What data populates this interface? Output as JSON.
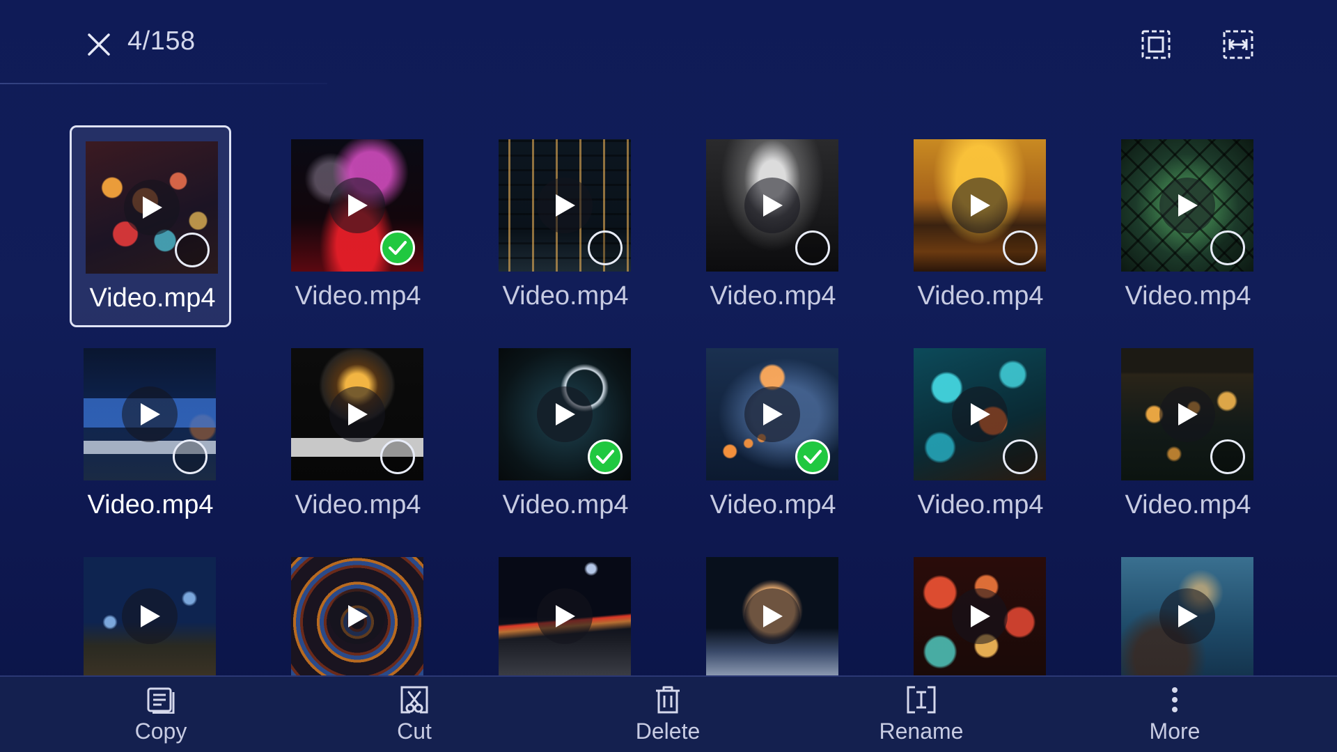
{
  "header": {
    "counter": "4/158",
    "close_icon": "close-icon",
    "select_all_icon": "select-all-icon",
    "select_range_icon": "select-range-icon"
  },
  "grid": {
    "items": [
      {
        "name": "Video.mp4",
        "selected": false,
        "focused": true,
        "theme": "bokeh-lights"
      },
      {
        "name": "Video.mp4",
        "selected": true,
        "focused": false,
        "theme": "fireworks-concert"
      },
      {
        "name": "Video.mp4",
        "selected": false,
        "focused": false,
        "theme": "night-city"
      },
      {
        "name": "Video.mp4",
        "selected": false,
        "focused": false,
        "theme": "concert-crowd"
      },
      {
        "name": "Video.mp4",
        "selected": false,
        "focused": false,
        "theme": "autumn-forest"
      },
      {
        "name": "Video.mp4",
        "selected": false,
        "focused": false,
        "theme": "green-window"
      },
      {
        "name": "Video.mp4",
        "selected": false,
        "focused": false,
        "theme": "control-room"
      },
      {
        "name": "Video.mp4",
        "selected": false,
        "focused": false,
        "theme": "light-bulb"
      },
      {
        "name": "Video.mp4",
        "selected": true,
        "focused": false,
        "theme": "dark-eclipse"
      },
      {
        "name": "Video.mp4",
        "selected": true,
        "focused": false,
        "theme": "starry-sky"
      },
      {
        "name": "Video.mp4",
        "selected": false,
        "focused": false,
        "theme": "teal-bokeh"
      },
      {
        "name": "Video.mp4",
        "selected": false,
        "focused": false,
        "theme": "string-lights"
      },
      {
        "name": "",
        "selected": false,
        "focused": false,
        "theme": "blue-butterflies"
      },
      {
        "name": "",
        "selected": false,
        "focused": false,
        "theme": "stained-glass"
      },
      {
        "name": "",
        "selected": false,
        "focused": false,
        "theme": "highway-night"
      },
      {
        "name": "",
        "selected": false,
        "focused": false,
        "theme": "frozen-bubble"
      },
      {
        "name": "",
        "selected": false,
        "focused": false,
        "theme": "lanterns"
      },
      {
        "name": "",
        "selected": false,
        "focused": false,
        "theme": "hand-lights"
      }
    ]
  },
  "bottombar": {
    "copy_label": "Copy",
    "cut_label": "Cut",
    "delete_label": "Delete",
    "rename_label": "Rename",
    "more_label": "More"
  },
  "colors": {
    "background": "#0f1b57",
    "bottom_bar": "#14204f",
    "check_selected": "#20c840",
    "text": "#c7cbe2"
  }
}
